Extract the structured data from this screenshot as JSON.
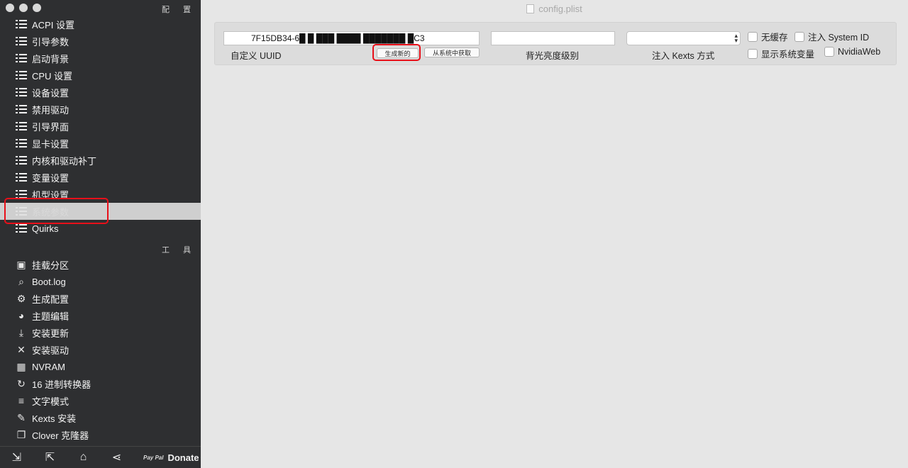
{
  "window": {
    "title": "config.plist"
  },
  "sidebar": {
    "config_section_label": "配 置",
    "tools_section_label": "工 具",
    "config_items": [
      {
        "label": "ACPI 设置"
      },
      {
        "label": "引导参数"
      },
      {
        "label": "启动背景"
      },
      {
        "label": "CPU 设置"
      },
      {
        "label": "设备设置"
      },
      {
        "label": "禁用驱动"
      },
      {
        "label": "引导界面"
      },
      {
        "label": "显卡设置"
      },
      {
        "label": "内核和驱动补丁"
      },
      {
        "label": "变量设置"
      },
      {
        "label": "机型设置"
      },
      {
        "label": "系统参数",
        "selected": true
      },
      {
        "label": "Quirks"
      }
    ],
    "tool_items": [
      {
        "label": "挂载分区",
        "icon": "disk-icon"
      },
      {
        "label": "Boot.log",
        "icon": "log-search-icon"
      },
      {
        "label": "生成配置",
        "icon": "gears-icon"
      },
      {
        "label": "主题编辑",
        "icon": "palette-icon"
      },
      {
        "label": "安装更新",
        "icon": "download-icon"
      },
      {
        "label": "安装驱动",
        "icon": "wrench-screwdriver-icon"
      },
      {
        "label": "NVRAM",
        "icon": "chip-icon"
      },
      {
        "label": "16 进制转换器",
        "icon": "refresh-icon"
      },
      {
        "label": "文字模式",
        "icon": "text-lines-icon"
      },
      {
        "label": "Kexts 安装",
        "icon": "pen-icon"
      },
      {
        "label": "Clover 克隆器",
        "icon": "copy-icon"
      }
    ],
    "bottom": {
      "donate_label": "Donate",
      "paypal_text": "Pay Pal"
    }
  },
  "main": {
    "uuid": {
      "value": "7F15DB34-6█ █ ███ ████ ███████ █C3",
      "label": "自定义 UUID",
      "generate_button": "生成新的",
      "get_from_system_button": "从系统中获取"
    },
    "backlight": {
      "value": "",
      "label": "背光亮度级别"
    },
    "inject_kexts": {
      "value": "",
      "label": "注入 Kexts 方式"
    },
    "checkboxes": {
      "no_caches": "无缓存",
      "inject_system_id": "注入 System ID",
      "show_system_vars": "显示系统变量",
      "nvidia_web": "NvidiaWeb"
    }
  },
  "annotations": {
    "highlight_color": "#e8101a"
  }
}
